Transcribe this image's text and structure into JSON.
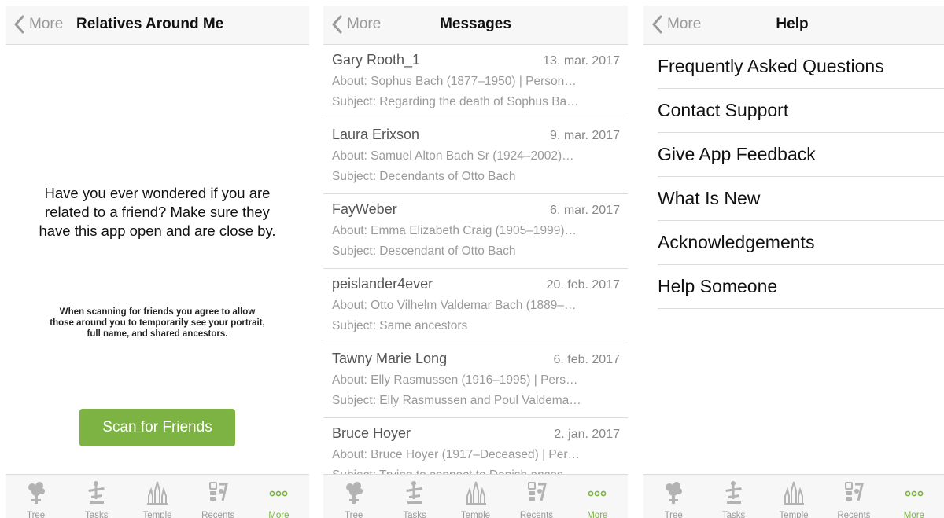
{
  "colors": {
    "accent": "#7cb342",
    "muted": "#9a9a9a",
    "divider": "#dcdcdc"
  },
  "back_label": "More",
  "screen1": {
    "title": "Relatives Around Me",
    "intro": "Have you ever wondered if you are related to a friend? Make sure they have this app open and are close by.",
    "fineprint": "When scanning for friends you agree to allow those around you to temporarily see your portrait, full name, and shared ancestors.",
    "button": "Scan for Friends"
  },
  "screen2": {
    "title": "Messages",
    "messages": [
      {
        "sender": "Gary Rooth_1",
        "date": "13. mar. 2017",
        "about": "About: Sophus Bach (1877–1950) | Person…",
        "subject": "Subject: Regarding the death of Sophus Ba…"
      },
      {
        "sender": "Laura Erixson",
        "date": "9. mar. 2017",
        "about": "About: Samuel Alton Bach Sr (1924–2002)…",
        "subject": "Subject: Decendants of Otto Bach"
      },
      {
        "sender": "FayWeber",
        "date": "6. mar. 2017",
        "about": "About: Emma Elizabeth Craig (1905–1999)…",
        "subject": "Subject: Descendant of Otto Bach"
      },
      {
        "sender": "peislander4ever",
        "date": "20. feb. 2017",
        "about": "About: Otto Vilhelm Valdemar Bach (1889–…",
        "subject": "Subject: Same ancestors"
      },
      {
        "sender": "Tawny Marie Long",
        "date": "6. feb. 2017",
        "about": "About: Elly Rasmussen (1916–1995) | Pers…",
        "subject": "Subject: Elly Rasmussen and Poul Valdema…"
      },
      {
        "sender": "Bruce Hoyer",
        "date": "2. jan. 2017",
        "about": "About: Bruce Hoyer (1917–Deceased) | Per…",
        "subject": "Subject: Trying to connect to Danish ances…"
      }
    ]
  },
  "screen3": {
    "title": "Help",
    "items": [
      "Frequently Asked Questions",
      "Contact Support",
      "Give App Feedback",
      "What Is New",
      "Acknowledgements",
      "Help Someone"
    ]
  },
  "tabs": [
    {
      "label": "Tree",
      "icon": "tree-icon"
    },
    {
      "label": "Tasks",
      "icon": "tasks-icon"
    },
    {
      "label": "Temple",
      "icon": "temple-icon"
    },
    {
      "label": "Recents",
      "icon": "recents-icon"
    },
    {
      "label": "More",
      "icon": "more-icon",
      "active": true
    }
  ]
}
